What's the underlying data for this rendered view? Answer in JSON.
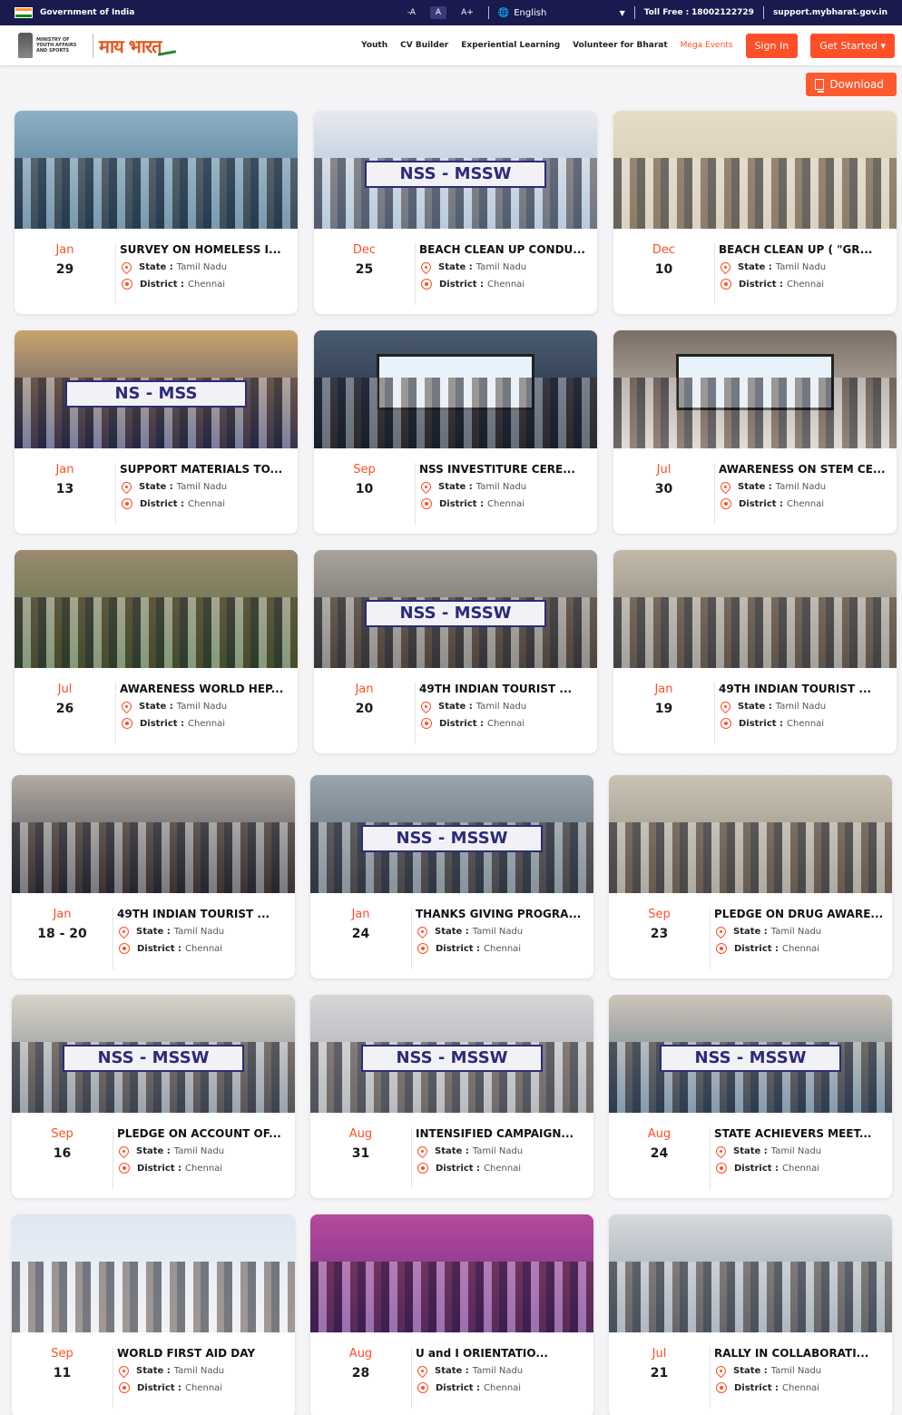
{
  "govbar": {
    "title": "Government of India",
    "font_small": "-A",
    "font_normal": "A",
    "font_large": "A+",
    "language": "English",
    "toll_free_label": "Toll Free :",
    "toll_free_number": "18002122729",
    "support_email": "support.mybharat.gov.in"
  },
  "header": {
    "ministry": "MINISTRY OF YOUTH AFFAIRS AND SPORTS",
    "logo_text": "माय भारत",
    "nav": [
      "Youth",
      "CV Builder",
      "Experiential Learning",
      "Volunteer for Bharat"
    ],
    "mega_events": "Mega Events",
    "sign_in": "Sign In",
    "get_started": "Get Started"
  },
  "download_label": "Download",
  "labels": {
    "state": "State :",
    "district": "District :"
  },
  "events": [
    {
      "month": "Jan",
      "day": "29",
      "title": "SURVEY ON HOMELESS I...",
      "state": "Tamil Nadu",
      "district": "Chennai"
    },
    {
      "month": "Dec",
      "day": "25",
      "title": "BEACH CLEAN UP CONDU...",
      "state": "Tamil Nadu",
      "district": "Chennai"
    },
    {
      "month": "Dec",
      "day": "10",
      "title": "BEACH CLEAN UP ( \"GR...",
      "state": "Tamil Nadu",
      "district": "Chennai"
    },
    {
      "month": "Jan",
      "day": "13",
      "title": "SUPPORT MATERIALS TO...",
      "state": "Tamil Nadu",
      "district": "Chennai"
    },
    {
      "month": "Sep",
      "day": "10",
      "title": "NSS INVESTITURE CERE...",
      "state": "Tamil Nadu",
      "district": "Chennai"
    },
    {
      "month": "Jul",
      "day": "30",
      "title": "AWARENESS ON STEM CE...",
      "state": "Tamil Nadu",
      "district": "Chennai"
    },
    {
      "month": "Jul",
      "day": "26",
      "title": "AWARENESS WORLD HEP...",
      "state": "Tamil Nadu",
      "district": "Chennai"
    },
    {
      "month": "Jan",
      "day": "20",
      "title": "49TH INDIAN TOURIST ...",
      "state": "Tamil Nadu",
      "district": "Chennai"
    },
    {
      "month": "Jan",
      "day": "19",
      "title": "49TH INDIAN TOURIST ...",
      "state": "Tamil Nadu",
      "district": "Chennai"
    },
    {
      "month": "Jan",
      "day": "18 - 20",
      "title": "49TH INDIAN TOURIST ...",
      "state": "Tamil Nadu",
      "district": "Chennai"
    },
    {
      "month": "Jan",
      "day": "24",
      "title": "THANKS GIVING PROGRA...",
      "state": "Tamil Nadu",
      "district": "Chennai"
    },
    {
      "month": "Sep",
      "day": "23",
      "title": "PLEDGE ON DRUG AWARE...",
      "state": "Tamil Nadu",
      "district": "Chennai"
    },
    {
      "month": "Sep",
      "day": "16",
      "title": "PLEDGE ON ACCOUNT OF...",
      "state": "Tamil Nadu",
      "district": "Chennai"
    },
    {
      "month": "Aug",
      "day": "31",
      "title": "INTENSIFIED CAMPAIGN...",
      "state": "Tamil Nadu",
      "district": "Chennai"
    },
    {
      "month": "Aug",
      "day": "24",
      "title": "STATE ACHIEVERS MEET...",
      "state": "Tamil Nadu",
      "district": "Chennai"
    },
    {
      "month": "Sep",
      "day": "11",
      "title": "WORLD FIRST AID DAY",
      "state": "Tamil Nadu",
      "district": "Chennai"
    },
    {
      "month": "Aug",
      "day": "28",
      "title": "U and I ORIENTATIO...",
      "state": "Tamil Nadu",
      "district": "Chennai"
    },
    {
      "month": "Jul",
      "day": "21",
      "title": "RALLY IN COLLABORATI...",
      "state": "Tamil Nadu",
      "district": "Chennai"
    }
  ],
  "photo_banners": [
    "",
    "NSS - MSSW",
    "",
    "NS - MSS",
    "",
    "",
    "",
    "NSS - MSSW",
    "",
    "",
    "NSS - MSSW",
    "",
    "NSS - MSSW",
    "NSS - MSSW",
    "NSS - MSSW",
    "",
    "",
    ""
  ],
  "colors": {
    "accent": "#ff4f26",
    "govbar": "#1a1a4e",
    "nss_blue": "#2b2b7c"
  }
}
